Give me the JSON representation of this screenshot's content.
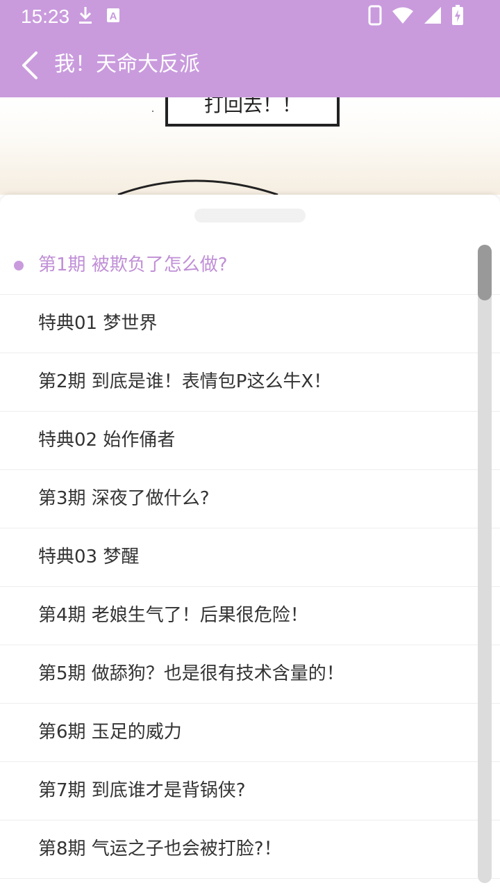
{
  "status_bar": {
    "time": "15:23",
    "left_icons": [
      "download-icon",
      "text-a-icon"
    ],
    "right_icons": [
      "phone-icon",
      "wifi-icon",
      "signal-icon",
      "battery-charging-icon"
    ],
    "background_color": "#c99bdd"
  },
  "app_bar": {
    "title": "我！天命大反派",
    "back_icon": "chevron-left-icon",
    "background_color": "#c99bdd"
  },
  "comic_preview": {
    "speech_text": "打回去！！"
  },
  "chapters": [
    {
      "label": "第1期 被欺负了怎么做?",
      "active": true
    },
    {
      "label": "特典01 梦世界",
      "active": false
    },
    {
      "label": "第2期 到底是谁！表情包P这么牛X！",
      "active": false
    },
    {
      "label": "特典02 始作俑者",
      "active": false
    },
    {
      "label": "第3期 深夜了做什么?",
      "active": false
    },
    {
      "label": "特典03 梦醒",
      "active": false
    },
    {
      "label": "第4期 老娘生气了！后果很危险！",
      "active": false
    },
    {
      "label": "第5期 做舔狗？也是很有技术含量的！",
      "active": false
    },
    {
      "label": "第6期 玉足的威力",
      "active": false
    },
    {
      "label": "第7期 到底谁才是背锅侠?",
      "active": false
    },
    {
      "label": "第8期 气运之子也会被打脸?！",
      "active": false
    }
  ],
  "colors": {
    "accent": "#c99bdd",
    "active_text": "#c08fd6",
    "text": "#333333"
  }
}
